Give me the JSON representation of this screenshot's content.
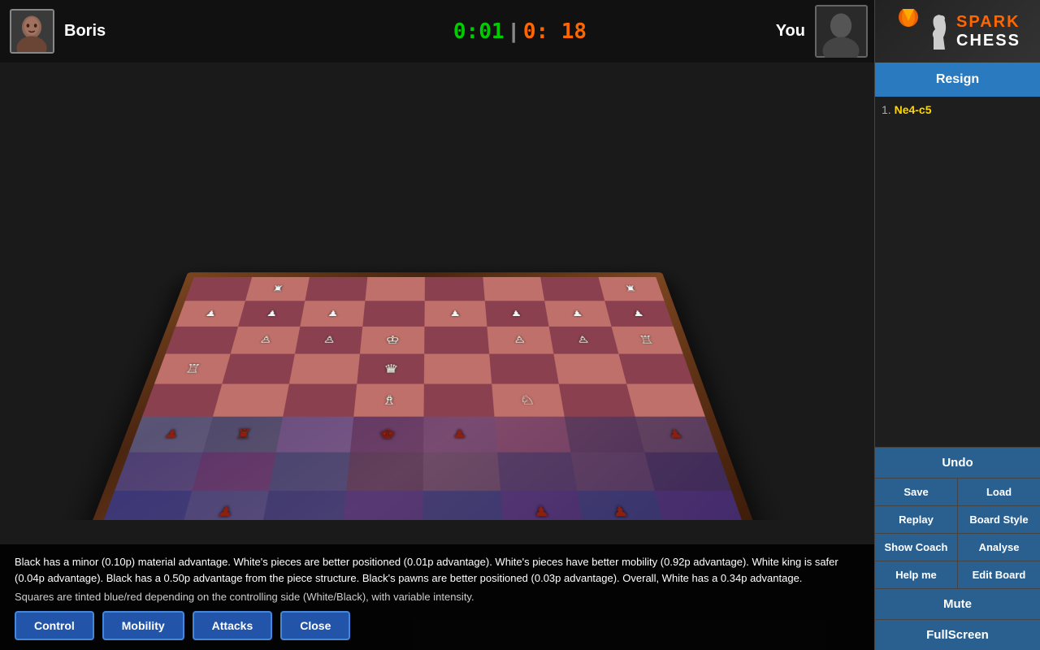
{
  "header": {
    "player_left": {
      "name": "Boris"
    },
    "timer_left": "0:01",
    "timer_right": "0: 18",
    "player_right": "You"
  },
  "logo": {
    "spark": "SPARK",
    "chess": "CHESS"
  },
  "panel": {
    "resign": "Resign",
    "undo": "Undo",
    "save": "Save",
    "load": "Load",
    "replay": "Replay",
    "board_style": "Board Style",
    "show_coach": "Show Coach",
    "analyse": "Analyse",
    "help_me": "Help me",
    "edit_board": "Edit Board",
    "mute": "Mute",
    "fullscreen": "FullScreen"
  },
  "moves": [
    {
      "number": "1.",
      "notation": "Ne4-c5"
    }
  ],
  "analysis": {
    "main_text": "Black has a minor (0.10p) material advantage. White's pieces are better positioned (0.01p advantage). White's pieces have better mobility (0.92p advantage). White king is safer (0.04p advantage). Black has a 0.50p advantage from the piece structure. Black's pawns are better positioned (0.03p advantage). Overall, White has a 0.34p advantage.",
    "sub_text": "Squares are tinted blue/red depending on the controlling side (White/Black), with variable intensity.",
    "btn_control": "Control",
    "btn_mobility": "Mobility",
    "btn_attacks": "Attacks",
    "btn_close": "Close"
  },
  "board": {
    "cells": [
      {
        "row": 0,
        "col": 0,
        "light": false,
        "tint": "none"
      },
      {
        "row": 0,
        "col": 1,
        "light": true,
        "tint": "none"
      },
      {
        "row": 0,
        "col": 2,
        "light": false,
        "tint": "none"
      },
      {
        "row": 0,
        "col": 3,
        "light": true,
        "tint": "none"
      },
      {
        "row": 0,
        "col": 4,
        "light": false,
        "tint": "none"
      },
      {
        "row": 0,
        "col": 5,
        "light": true,
        "tint": "none"
      },
      {
        "row": 0,
        "col": 6,
        "light": false,
        "tint": "none"
      },
      {
        "row": 0,
        "col": 7,
        "light": true,
        "tint": "none"
      },
      {
        "row": 1,
        "col": 0,
        "light": true,
        "tint": "none"
      },
      {
        "row": 1,
        "col": 1,
        "light": false,
        "tint": "none"
      },
      {
        "row": 1,
        "col": 2,
        "light": true,
        "tint": "none"
      },
      {
        "row": 1,
        "col": 3,
        "light": false,
        "tint": "none"
      },
      {
        "row": 1,
        "col": 4,
        "light": true,
        "tint": "none"
      },
      {
        "row": 1,
        "col": 5,
        "light": false,
        "tint": "none"
      },
      {
        "row": 1,
        "col": 6,
        "light": true,
        "tint": "none"
      },
      {
        "row": 1,
        "col": 7,
        "light": false,
        "tint": "none"
      }
    ]
  }
}
